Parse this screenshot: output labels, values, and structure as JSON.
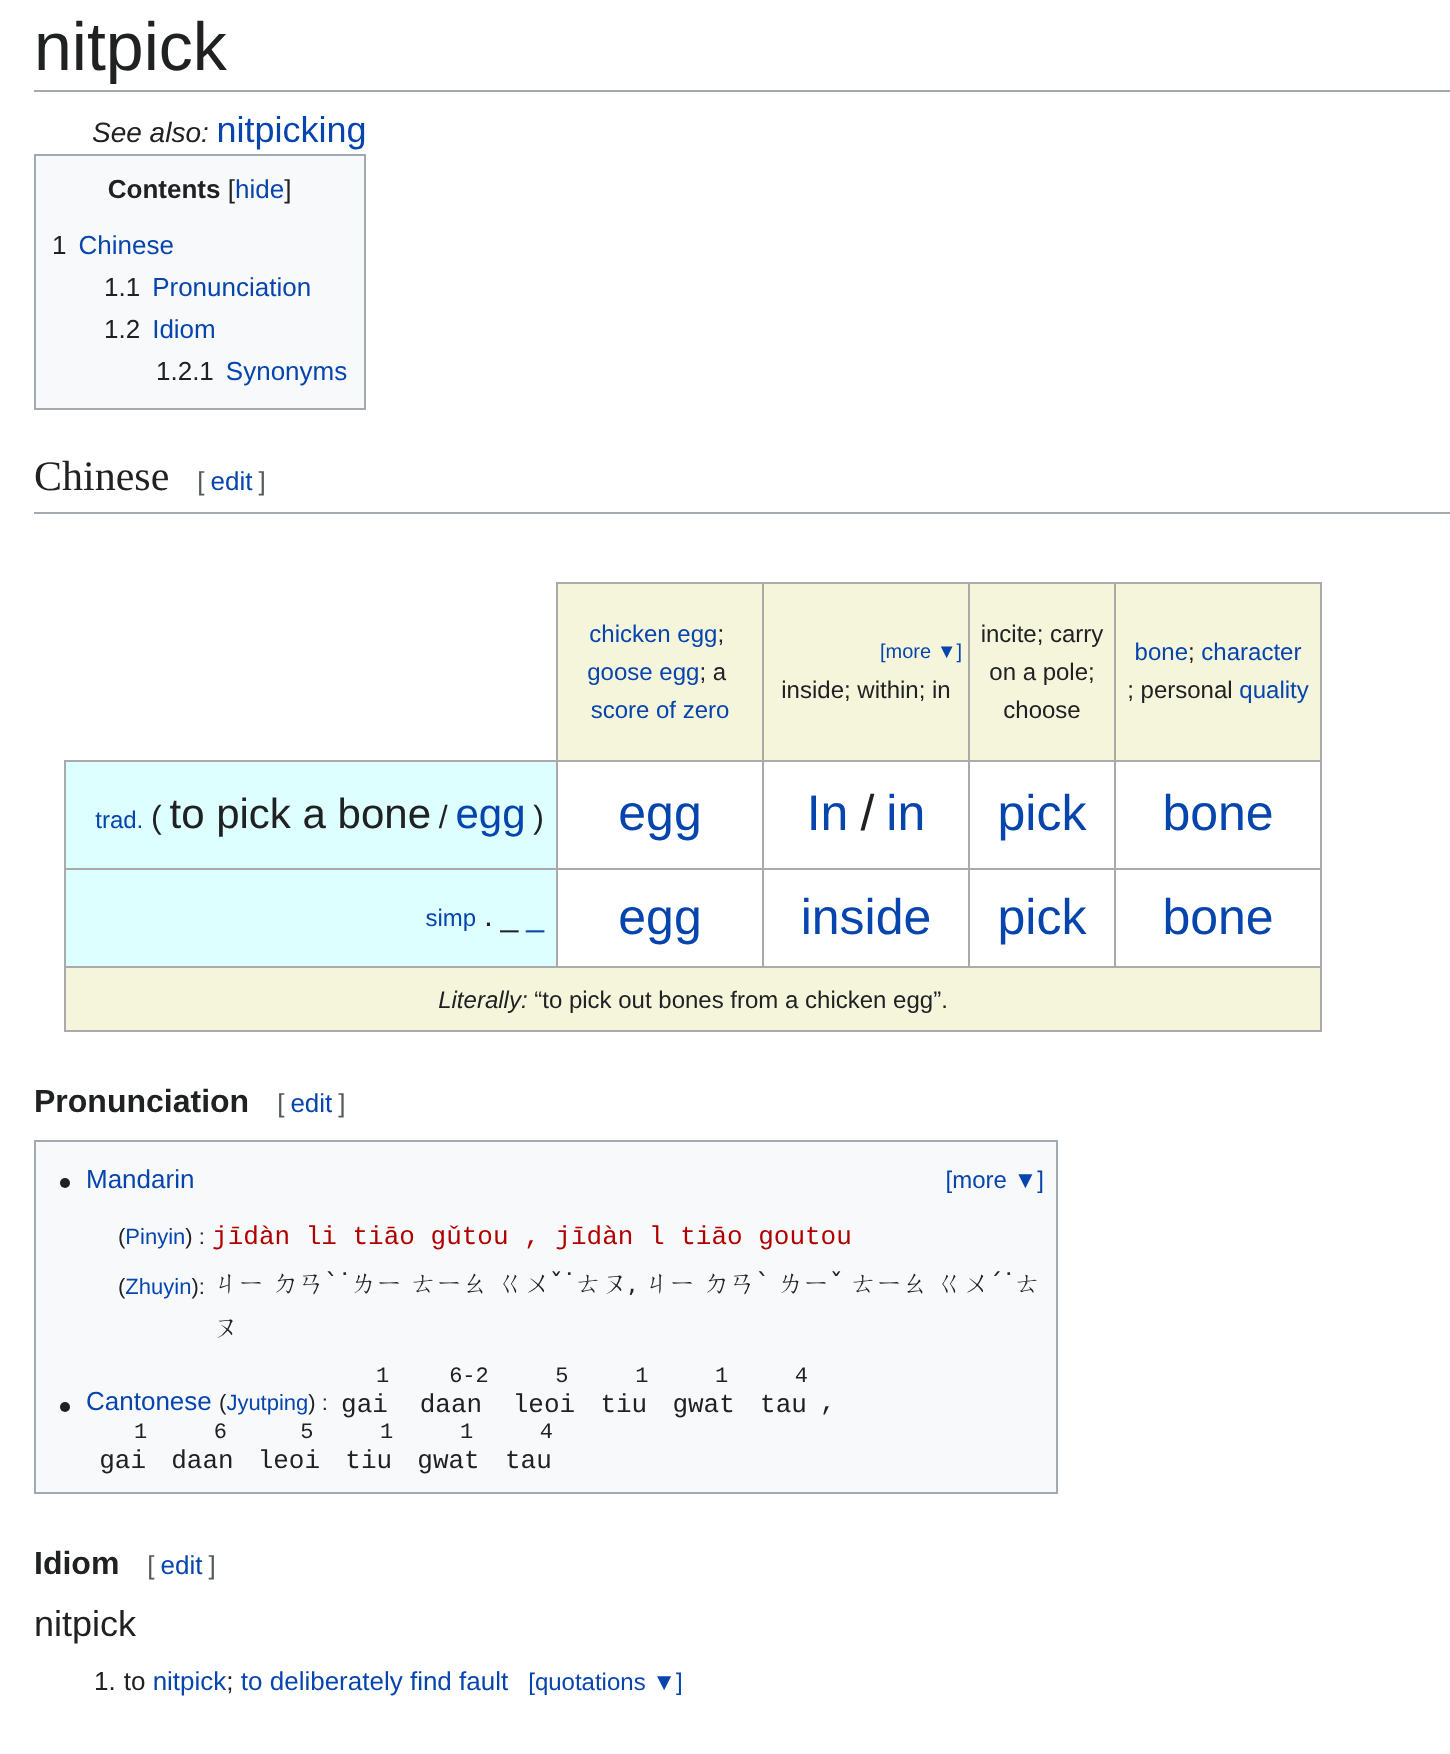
{
  "page_title": "nitpick",
  "see_also": {
    "label": "See also:",
    "link": "nitpicking"
  },
  "toc": {
    "title": "Contents",
    "brackets": [
      "[",
      "]"
    ],
    "toggle": "hide",
    "items": [
      {
        "number": "1",
        "label": "Chinese",
        "children": [
          {
            "number": "1.1",
            "label": "Pronunciation"
          },
          {
            "number": "1.2",
            "label": "Idiom",
            "children": [
              {
                "number": "1.2.1",
                "label": "Synonyms"
              }
            ]
          }
        ]
      }
    ]
  },
  "chinese_section": {
    "heading": "Chinese",
    "brackets": [
      "[",
      "]"
    ],
    "edit": "edit"
  },
  "table": {
    "glosses": [
      {
        "segments": [
          {
            "text": "chicken egg",
            "link": true
          },
          {
            "text": "; ",
            "link": false
          },
          {
            "text": "goose egg",
            "link": true
          },
          {
            "text": "; a ",
            "link": false
          },
          {
            "text": "score of zero",
            "link": true
          }
        ]
      },
      {
        "more": "[more ▼]",
        "segments": [
          {
            "text": "inside; within; in",
            "link": false
          }
        ]
      },
      {
        "segments": [
          {
            "text": "incite; carry on a pole; choose",
            "link": false
          }
        ]
      },
      {
        "segments": [
          {
            "text": "bone",
            "link": true
          },
          {
            "text": "; ",
            "link": false
          },
          {
            "text": "character",
            "link": true
          },
          {
            "text": "; personal ",
            "link": false
          },
          {
            "text": "quality",
            "link": true
          }
        ]
      }
    ],
    "rows": [
      {
        "label": "trad.",
        "open": "(",
        "words": [
          {
            "text": "to pick a bone",
            "link": false
          },
          {
            "text": "/",
            "link": false
          },
          {
            "text": "egg",
            "link": true
          }
        ],
        "close": ")",
        "cells": [
          [
            {
              "text": "egg",
              "link": true
            }
          ],
          [
            {
              "text": "In",
              "link": true
            },
            {
              "text": "/",
              "link": false
            },
            {
              "text": "in",
              "link": true
            }
          ],
          [
            {
              "text": "pick",
              "link": true
            }
          ],
          [
            {
              "text": "bone",
              "link": true
            }
          ]
        ]
      },
      {
        "label": "simp",
        "words": [
          {
            "text": ".",
            "link": false
          },
          {
            "text": "_",
            "link": false
          },
          {
            "text": "_",
            "link": true
          }
        ],
        "cells": [
          [
            {
              "text": "egg",
              "link": true
            }
          ],
          [
            {
              "text": "inside",
              "link": true
            }
          ],
          [
            {
              "text": "pick",
              "link": true
            }
          ],
          [
            {
              "text": "bone",
              "link": true
            }
          ]
        ]
      }
    ],
    "literally": {
      "label": "Literally:",
      "text": "“to pick out bones from a chicken egg”."
    }
  },
  "pronunciation": {
    "heading": "Pronunciation",
    "brackets": [
      "[",
      "]"
    ],
    "edit": "edit",
    "more": "[more ▼]",
    "mandarin": {
      "label": "Mandarin",
      "pinyin_prefix": [
        {
          "text": "(",
          "link": false
        },
        {
          "text": "Pinyin",
          "link": true
        },
        {
          "text": ") :",
          "link": false
        }
      ],
      "pinyin": "jīdàn li tiāo gǔtou , jīdàn l tiāo goutou",
      "zhuyin_prefix": [
        {
          "text": "(",
          "link": false
        },
        {
          "text": "Zhuyin",
          "link": true
        },
        {
          "text": "):",
          "link": false
        }
      ],
      "zhuyin": "ㄐㄧ ㄉㄢˋ˙ㄌㄧ ㄊㄧㄠ ㄍㄨˇ˙ㄊㄡ, ㄐㄧ ㄉㄢˋ ㄌㄧˇ ㄊㄧㄠ ㄍㄨˊ˙ㄊㄡ"
    },
    "cantonese": {
      "label": "Cantonese",
      "jyutping_prefix": [
        {
          "text": "(",
          "link": false
        },
        {
          "text": "Jyutping",
          "link": true
        },
        {
          "text": ") :",
          "link": false
        }
      ],
      "separator": ",",
      "groups": [
        [
          {
            "syllable": "gai",
            "tone": "1"
          },
          {
            "syllable": "daan",
            "tone": "6-2"
          },
          {
            "syllable": "leoi",
            "tone": "5"
          },
          {
            "syllable": "tiu",
            "tone": "1"
          },
          {
            "syllable": "gwat",
            "tone": "1"
          },
          {
            "syllable": "tau",
            "tone": "4"
          }
        ],
        [
          {
            "syllable": "gai",
            "tone": "1"
          },
          {
            "syllable": "daan",
            "tone": "6"
          },
          {
            "syllable": "leoi",
            "tone": "5"
          },
          {
            "syllable": "tiu",
            "tone": "1"
          },
          {
            "syllable": "gwat",
            "tone": "1"
          },
          {
            "syllable": "tau",
            "tone": "4"
          }
        ]
      ]
    }
  },
  "idiom": {
    "heading": "Idiom",
    "brackets": [
      "[",
      "]"
    ],
    "edit": "edit",
    "headword": "nitpick",
    "senses": [
      {
        "number": "1.",
        "segments": [
          {
            "text": "to ",
            "link": false
          },
          {
            "text": "nitpick",
            "link": true
          },
          {
            "text": "; ",
            "link": false
          },
          {
            "text": "to deliberately find fault",
            "link": true
          }
        ],
        "quotations": "[quotations ▼]"
      }
    ]
  }
}
